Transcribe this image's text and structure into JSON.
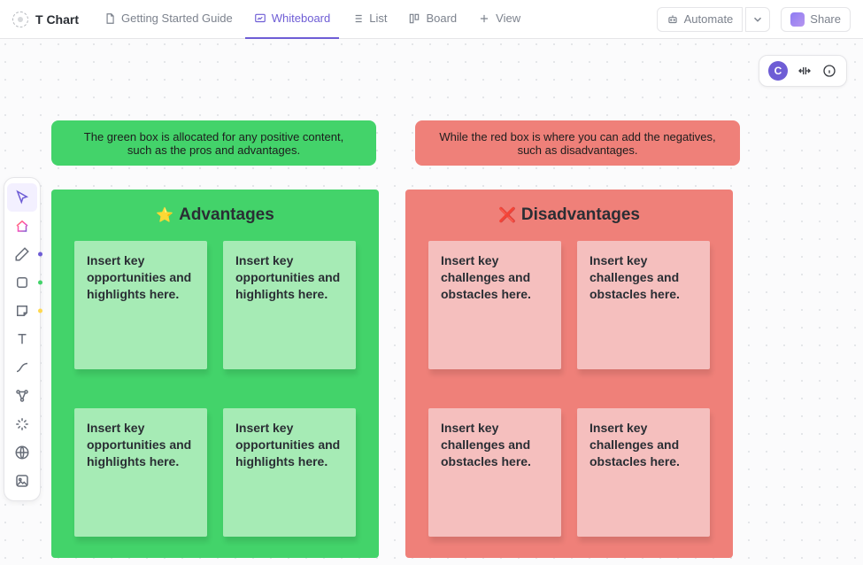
{
  "app_title": "T Chart",
  "tabs": {
    "guide": "Getting Started Guide",
    "whiteboard": "Whiteboard",
    "list": "List",
    "board": "Board",
    "addview": "View"
  },
  "topbar": {
    "automate": "Automate",
    "share": "Share"
  },
  "avatar_letter": "C",
  "descriptions": {
    "positive": "The green box is allocated for any positive content, such as the pros and advantages.",
    "negative": "While the red box is where you can add the negatives, such as disadvantages."
  },
  "columns": {
    "advantages": {
      "heading": "Advantages",
      "icon": "⭐",
      "notes": [
        "Insert key opportunities and highlights here.",
        "Insert key opportunities and highlights here.",
        "Insert key opportunities and highlights here.",
        "Insert key opportunities and highlights here."
      ]
    },
    "disadvantages": {
      "heading": "Disadvantages",
      "icon": "❌",
      "notes": [
        "Insert key challenges and obstacles here.",
        "Insert key challenges and obstacles here.",
        "Insert key challenges and obstacles here.",
        "Insert key challenges and obstacles here."
      ]
    }
  },
  "tool_colors": {
    "pen_dot": "#6e5dd5",
    "shape_dot": "#43d36a",
    "sticky_dot": "#ffd84f"
  }
}
